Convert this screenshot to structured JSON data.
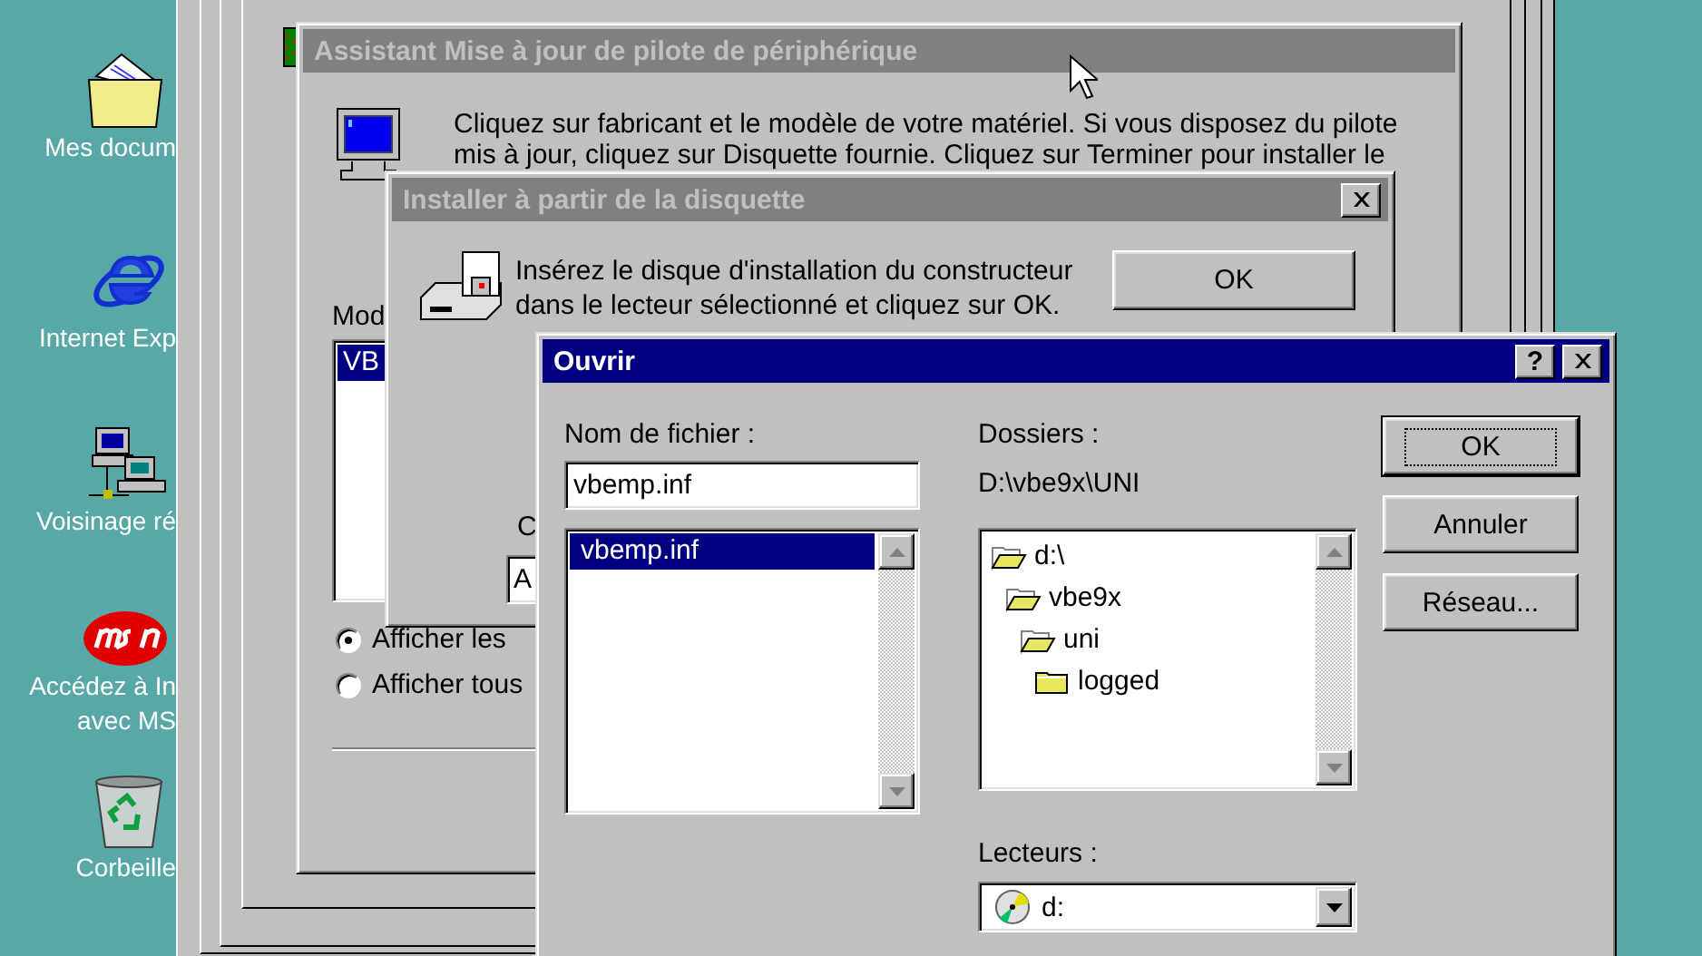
{
  "desktop_icons": [
    {
      "kind": "folder",
      "lines": [
        "Mes docum"
      ]
    },
    {
      "kind": "browser",
      "lines": [
        "Internet Exp"
      ]
    },
    {
      "kind": "network",
      "lines": [
        "Voisinage ré"
      ]
    },
    {
      "kind": "msn",
      "lines": [
        "Accédez à In",
        "avec MS"
      ]
    },
    {
      "kind": "recycle",
      "lines": [
        "Corbeille"
      ]
    }
  ],
  "wizard": {
    "title": "Assistant Mise à jour de pilote de périphérique",
    "active": false,
    "instructions": [
      "Cliquez sur fabricant et le modèle de votre matériel. Si vous disposez du pilote",
      "mis à jour, cliquez sur Disquette fournie. Cliquez sur Terminer pour installer le"
    ],
    "models_label": "Mod",
    "models": [
      {
        "label": "VB",
        "selected": true
      }
    ],
    "options": [
      {
        "label": "Afficher les",
        "selected": true
      },
      {
        "label": "Afficher tous",
        "selected": false
      }
    ]
  },
  "install_dialog": {
    "title": "Installer à partir de la disquette",
    "active": false,
    "message": [
      "Insérez le disque d'installation du constructeur",
      "dans le lecteur sélectionné et cliquez sur OK."
    ],
    "ok_button": "OK",
    "label_2": "C",
    "field_2": "A"
  },
  "open_dialog": {
    "title": "Ouvrir",
    "active": true,
    "help_button": "?",
    "filename_label": "Nom de fichier :",
    "filename": "vbemp.inf",
    "files": [
      {
        "name": "vbemp.inf",
        "selected": true
      }
    ],
    "folders_label": "Dossiers :",
    "current_path": "D:\\vbe9x\\UNI",
    "folders": [
      {
        "name": "d:\\",
        "open": true,
        "children": [
          {
            "name": "vbe9x",
            "open": true,
            "children": [
              {
                "name": "uni",
                "open": true,
                "children": [
                  {
                    "name": "logged",
                    "open": false
                  }
                ]
              }
            ]
          }
        ]
      }
    ],
    "drives_label": "Lecteurs :",
    "drive": "d:",
    "buttons": [
      {
        "label": "OK",
        "default": true
      },
      {
        "label": "Annuler",
        "default": false
      },
      {
        "label": "Réseau...",
        "default": false
      }
    ]
  }
}
